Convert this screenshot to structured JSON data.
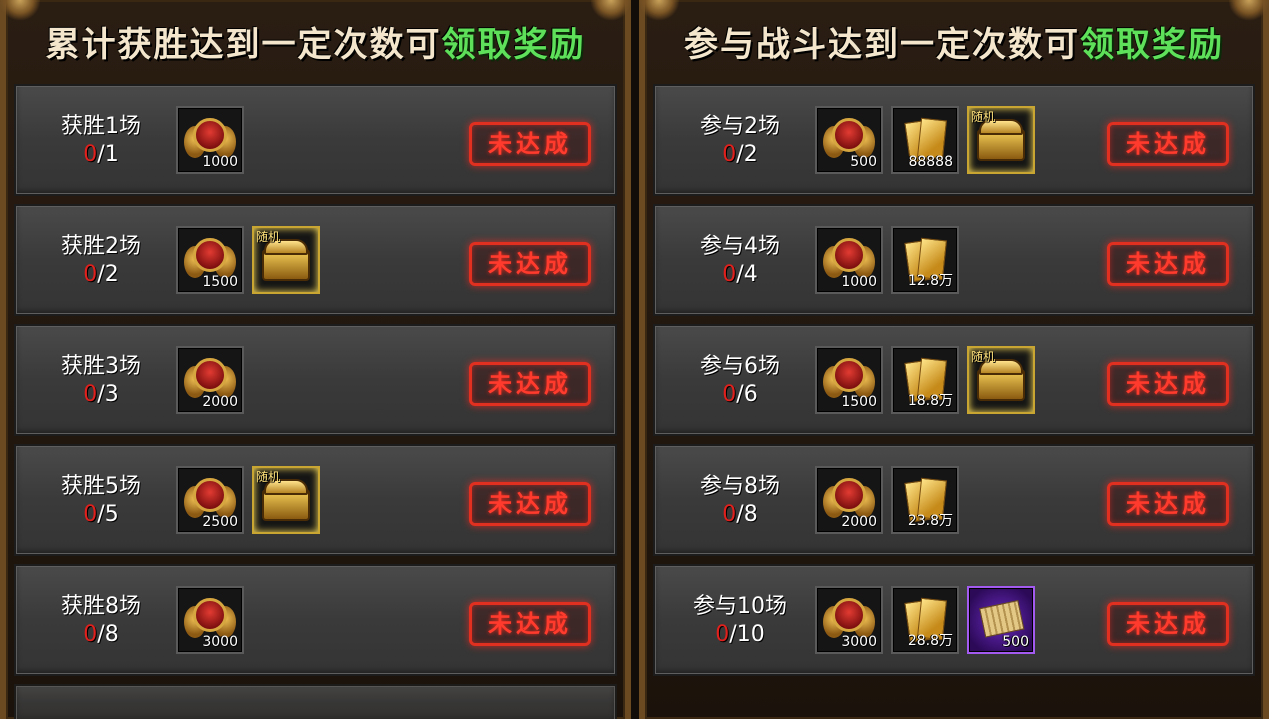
{
  "left_panel": {
    "title_main": "累计获胜达到一定次数可",
    "title_highlight": "领取奖励",
    "rows": [
      {
        "label": "获胜1场",
        "current": "0",
        "target": "/1",
        "rewards": [
          {
            "type": "medal-icon",
            "qty": "1000"
          }
        ],
        "status": "未达成"
      },
      {
        "label": "获胜2场",
        "current": "0",
        "target": "/2",
        "rewards": [
          {
            "type": "medal-icon",
            "qty": "1500"
          },
          {
            "type": "chest-icon",
            "tag": "随机",
            "qty": ""
          }
        ],
        "status": "未达成"
      },
      {
        "label": "获胜3场",
        "current": "0",
        "target": "/3",
        "rewards": [
          {
            "type": "medal-icon",
            "qty": "2000"
          }
        ],
        "status": "未达成"
      },
      {
        "label": "获胜5场",
        "current": "0",
        "target": "/5",
        "rewards": [
          {
            "type": "medal-icon",
            "qty": "2500"
          },
          {
            "type": "chest-icon",
            "tag": "随机",
            "qty": ""
          }
        ],
        "status": "未达成"
      },
      {
        "label": "获胜8场",
        "current": "0",
        "target": "/8",
        "rewards": [
          {
            "type": "medal-icon",
            "qty": "3000"
          }
        ],
        "status": "未达成"
      }
    ]
  },
  "right_panel": {
    "title_main": "参与战斗达到一定次数可",
    "title_highlight": "领取奖励",
    "rows": [
      {
        "label": "参与2场",
        "current": "0",
        "target": "/2",
        "rewards": [
          {
            "type": "medal-icon",
            "qty": "500"
          },
          {
            "type": "ticket-icon",
            "qty": "88888"
          },
          {
            "type": "chest-icon",
            "tag": "随机",
            "qty": ""
          }
        ],
        "status": "未达成"
      },
      {
        "label": "参与4场",
        "current": "0",
        "target": "/4",
        "rewards": [
          {
            "type": "medal-icon",
            "qty": "1000"
          },
          {
            "type": "ticket-icon",
            "qty": "12.8万"
          }
        ],
        "status": "未达成"
      },
      {
        "label": "参与6场",
        "current": "0",
        "target": "/6",
        "rewards": [
          {
            "type": "medal-icon",
            "qty": "1500"
          },
          {
            "type": "ticket-icon",
            "qty": "18.8万"
          },
          {
            "type": "chest-icon",
            "tag": "随机",
            "qty": ""
          }
        ],
        "status": "未达成"
      },
      {
        "label": "参与8场",
        "current": "0",
        "target": "/8",
        "rewards": [
          {
            "type": "medal-icon",
            "qty": "2000"
          },
          {
            "type": "ticket-icon",
            "qty": "23.8万"
          }
        ],
        "status": "未达成"
      },
      {
        "label": "参与10场",
        "current": "0",
        "target": "/10",
        "rewards": [
          {
            "type": "medal-icon",
            "qty": "3000"
          },
          {
            "type": "ticket-icon",
            "qty": "28.8万"
          },
          {
            "type": "scroll-icon",
            "qty": "500"
          }
        ],
        "status": "未达成"
      }
    ]
  },
  "colors": {
    "highlight": "#5ee05a",
    "progress_current": "#e0201c",
    "status": "#ff3b2e"
  }
}
